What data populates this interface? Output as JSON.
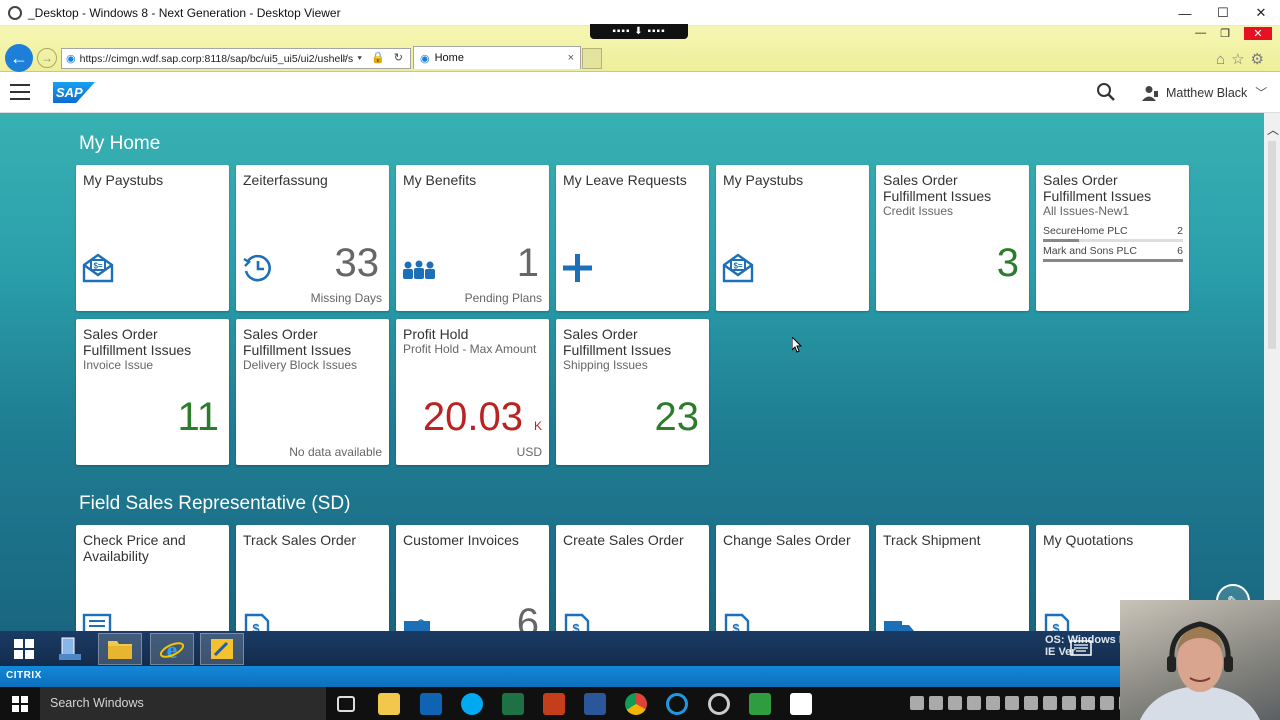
{
  "window": {
    "title": "_Desktop - Windows 8 - Next Generation - Desktop Viewer",
    "minimize": "—",
    "maximize": "☐",
    "close": "✕"
  },
  "browser": {
    "url": "https://cimgn.wdf.sap.corp:8118/sap/bc/ui5_ui5/ui2/ushell/s",
    "tab_title": "Home",
    "tab_close": "×"
  },
  "shell": {
    "logo": "SAP",
    "user_name": "Matthew Black"
  },
  "groups": [
    {
      "title": "My Home"
    },
    {
      "title": "Field Sales Representative (SD)"
    }
  ],
  "tiles_home": [
    {
      "title": "My Paystubs",
      "icon": "paystub-icon"
    },
    {
      "title": "Zeiterfassung",
      "number": "33",
      "footer": "Missing Days",
      "icon": "clock-icon"
    },
    {
      "title": "My Benefits",
      "number": "1",
      "footer": "Pending Plans",
      "icon": "people-icon"
    },
    {
      "title": "My Leave Requests",
      "icon": "plus-icon"
    },
    {
      "title": "My Paystubs",
      "icon": "paystub-icon"
    },
    {
      "title": "Sales Order Fulfillment Issues",
      "subtitle": "Credit Issues",
      "number": "3"
    },
    {
      "title": "Sales Order Fulfillment Issues",
      "subtitle": "All Issues-New1",
      "bars": [
        {
          "label": "SecureHome PLC",
          "value": "2",
          "fraction": 0.26
        },
        {
          "label": "Mark and Sons PLC",
          "value": "6",
          "fraction": 1.0
        }
      ]
    },
    {
      "title": "Sales Order Fulfillment Issues",
      "subtitle": "Invoice Issue",
      "number": "11"
    },
    {
      "title": "Sales Order Fulfillment Issues",
      "subtitle": "Delivery Block Issues",
      "footer": "No data available"
    },
    {
      "title": "Profit Hold",
      "subtitle": "Profit Hold - Max Amount",
      "number": "20.03",
      "scale": "K",
      "footer": "USD"
    },
    {
      "title": "Sales Order Fulfillment Issues",
      "subtitle": "Shipping Issues",
      "number": "23"
    }
  ],
  "tiles_sales": [
    {
      "title": "Check Price and Availability"
    },
    {
      "title": "Track Sales Order"
    },
    {
      "title": "Customer Invoices",
      "number": "6"
    },
    {
      "title": "Create Sales Order"
    },
    {
      "title": "Change Sales Order"
    },
    {
      "title": "Track Shipment"
    },
    {
      "title": "My Quotations"
    }
  ],
  "remote_os_watermark": [
    "OS: Windows N",
    "IE Ver"
  ],
  "citrix_label": "CITRIX",
  "local_taskbar": {
    "search_placeholder": "Search Windows"
  },
  "colors": {
    "accent": "#2b7c2b",
    "negative": "#bb2222",
    "shell_bg": "#2a9fab",
    "sap_blue": "#0a6ed1"
  }
}
